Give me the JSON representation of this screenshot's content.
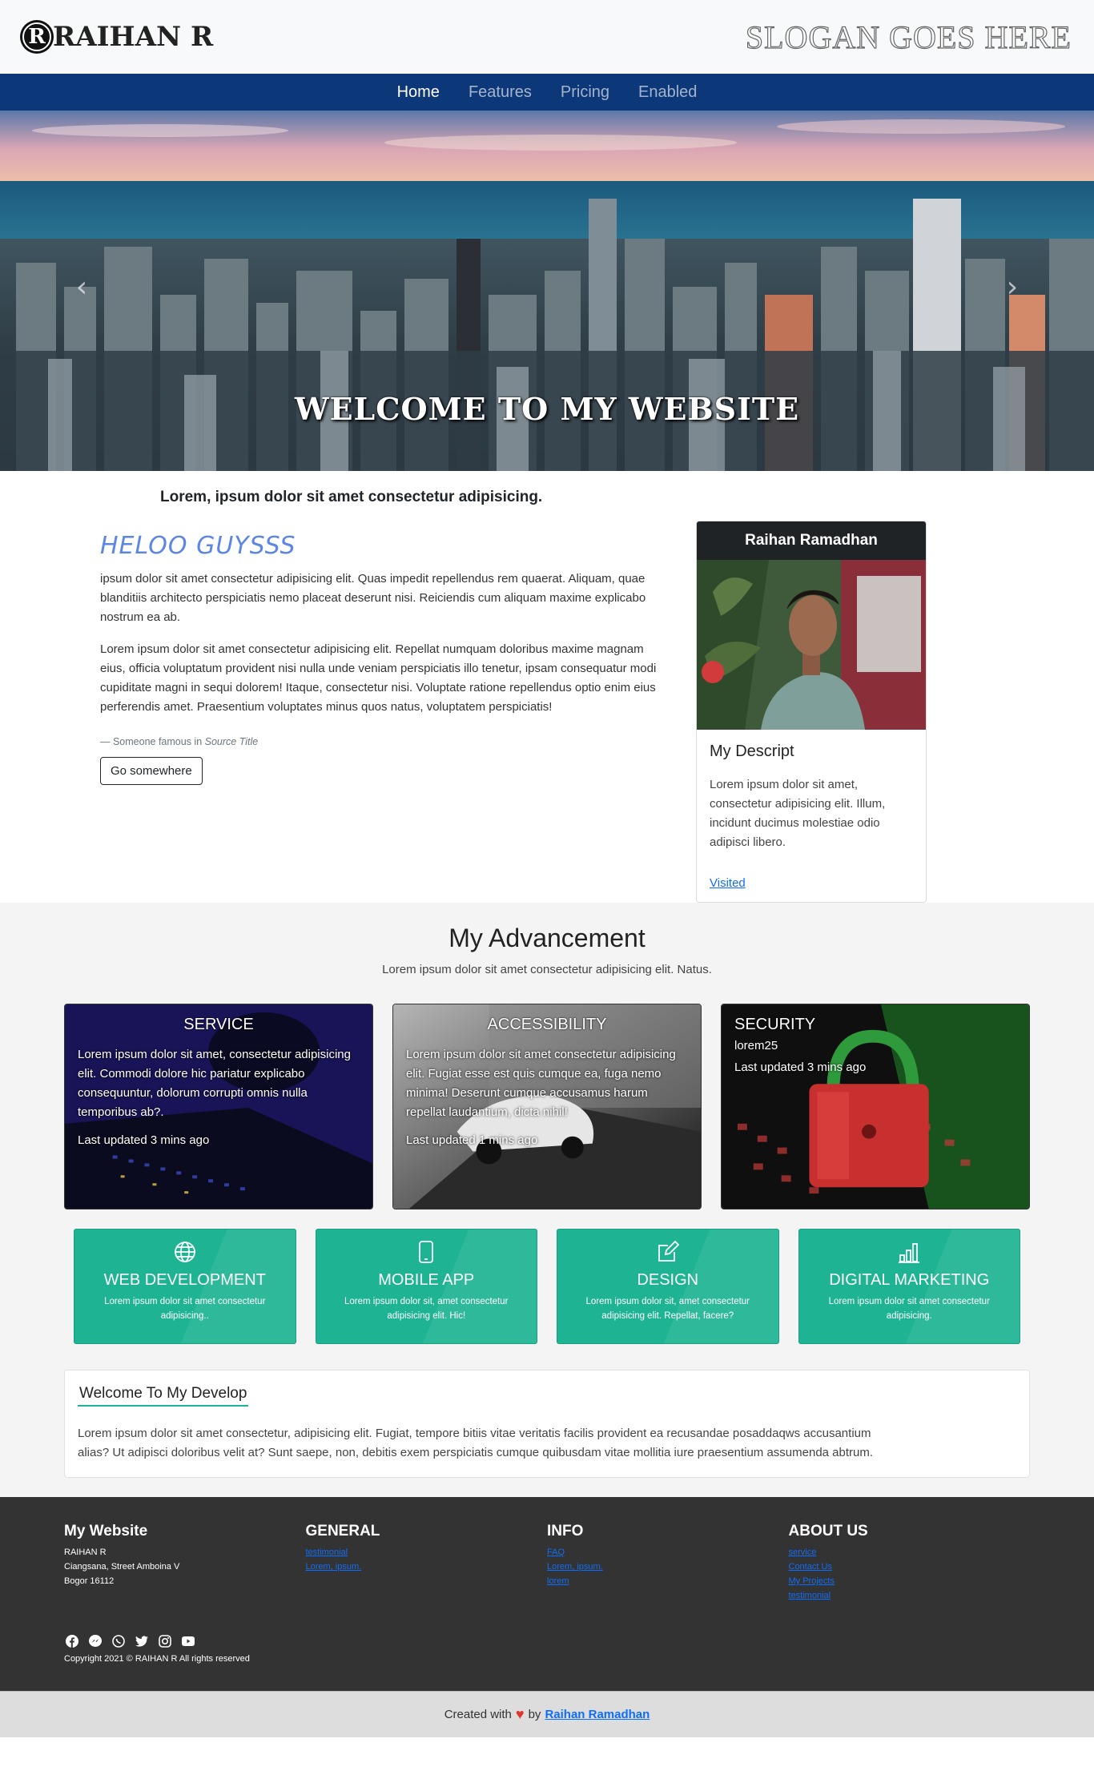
{
  "header": {
    "brand_logo_letter": "R",
    "brand_name": "RAIHAN R",
    "slogan": "SLOGAN GOES HERE"
  },
  "nav": {
    "items": [
      {
        "label": "Home",
        "active": true
      },
      {
        "label": "Features",
        "active": false
      },
      {
        "label": "Pricing",
        "active": false
      },
      {
        "label": "Enabled",
        "active": false
      }
    ]
  },
  "hero": {
    "caption": "WELCOME TO MY WEBSITE",
    "prev_icon": "chevron-left-icon",
    "next_icon": "chevron-right-icon"
  },
  "about": {
    "lead": "Lorem, ipsum dolor sit amet consectetur adipisicing.",
    "heading": "HELOO GUYSSS",
    "paragraph1": "ipsum dolor sit amet consectetur adipisicing elit. Quas impedit repellendus rem quaerat. Aliquam, quae blanditiis architecto perspiciatis nemo placeat deserunt nisi. Reiciendis cum aliquam maxime explicabo nostrum ea ab.",
    "paragraph2": "Lorem ipsum dolor sit amet consectetur adipisicing elit. Repellat numquam doloribus maxime magnam eius, officia voluptatum provident nisi nulla unde veniam perspiciatis illo tenetur, ipsam consequatur modi cupiditate magni in sequi dolorem! Itaque, consectetur nisi. Voluptate ratione repellendus optio enim eius perferendis amet. Praesentium voluptates minus quos natus, voluptatem perspiciatis!",
    "quote_author": "— Someone famous in",
    "quote_source": "Source Title",
    "button_label": "Go somewhere"
  },
  "profile": {
    "name": "Raihan Ramadhan",
    "title": "My Descript",
    "text": "Lorem ipsum dolor sit amet, consectetur adipisicing elit. Illum, incidunt ducimus molestiae odio adipisci libero.",
    "link_label": "Visited"
  },
  "advancement": {
    "heading": "My Advancement",
    "subheading": "Lorem ipsum dolor sit amet consectetur adipisicing elit. Natus.",
    "cards": [
      {
        "title": "SERVICE",
        "text": "Lorem ipsum dolor sit amet, consectetur adipisicing elit. Commodi dolore hic pariatur explicabo consequuntur, dolorum corrupti omnis nulla temporibus ab?.",
        "updated": "Last updated 3 mins ago"
      },
      {
        "title": "ACCESSIBILITY",
        "text": "Lorem ipsum dolor sit amet consectetur adipisicing elit. Fugiat esse est quis cumque ea, fuga nemo minima! Deserunt cumque accusamus harum repellat laudantium, dicta nihil!",
        "updated": "Last updated 1 mins ago"
      },
      {
        "title": "SECURITY",
        "text": "lorem25",
        "updated": "Last updated 3 mins ago"
      }
    ],
    "features": [
      {
        "icon": "globe-icon",
        "title": "WEB DEVELOPMENT",
        "text": "Lorem ipsum dolor sit amet consectetur adipisicing.."
      },
      {
        "icon": "phone-icon",
        "title": "MOBILE APP",
        "text": "Lorem ipsum dolor sit, amet consectetur adipisicing elit. Hic!"
      },
      {
        "icon": "edit-icon",
        "title": "DESIGN",
        "text": "Lorem ipsum dolor sit, amet consectetur adipisicing elit. Repellat, facere?"
      },
      {
        "icon": "bar-chart-icon",
        "title": "DIGITAL MARKETING",
        "text": "Lorem ipsum dolor sit amet consectetur adipisicing."
      }
    ],
    "develop_title": "Welcome To My Develop",
    "develop_text": "Lorem ipsum dolor sit amet consectetur, adipisicing elit. Fugiat, tempore bitiis vitae veritatis facilis provident ea recusandae posaddaqws accusantium alias? Ut adipisci doloribus velit at? Sunt saepe, non, debitis exem perspiciatis cumque quibusdam vitae mollitia iure praesentium assumenda abtrum."
  },
  "footer": {
    "site_title": "My Website",
    "address_name": "RAIHAN R",
    "address_street": "Ciangsana, Street Amboina V",
    "address_city": "Bogor 16112",
    "general_title": "GENERAL",
    "general_links": [
      "testimonial",
      "Lorem, ipsum."
    ],
    "info_title": "INFO",
    "info_links": [
      "FAQ",
      "Lorem, ipsum.",
      "lorem"
    ],
    "about_title": "ABOUT US",
    "about_links": [
      "service",
      "Contact Us",
      "My Projects",
      "testimonial"
    ],
    "social_icons": [
      "facebook-icon",
      "messenger-icon",
      "whatsapp-icon",
      "twitter-icon",
      "instagram-icon",
      "youtube-icon"
    ],
    "copyright": "Copyright 2021 © RAIHAN R All rights reserved"
  },
  "credits": {
    "prefix": "Created with",
    "heart": "♥",
    "by": "by",
    "author": "Raihan Ramadhan"
  }
}
